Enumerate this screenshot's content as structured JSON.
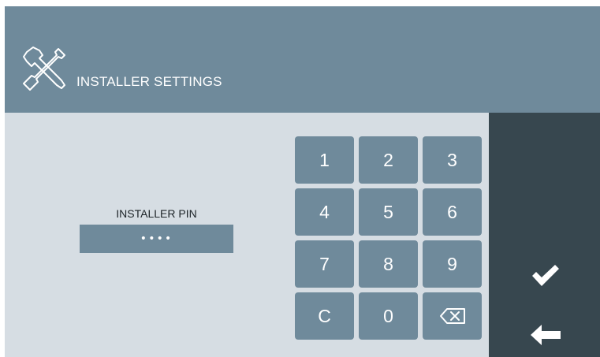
{
  "header": {
    "title": "INSTALLER SETTINGS",
    "icon": "tools-icon"
  },
  "pin": {
    "label": "INSTALLER PIN",
    "value": "••••"
  },
  "keypad": {
    "keys": [
      "1",
      "2",
      "3",
      "4",
      "5",
      "6",
      "7",
      "8",
      "9",
      "C",
      "0"
    ],
    "backspace_icon": "backspace-icon"
  },
  "sidebar": {
    "confirm_icon": "checkmark-icon",
    "back_icon": "arrow-left-icon"
  },
  "colors": {
    "header_bg": "#6f8a9b",
    "main_bg": "#d6dde3",
    "sidebar_bg": "#37474f",
    "key_bg": "#6f8a9b",
    "text_light": "#ffffff",
    "text_dark": "#1c2327"
  }
}
